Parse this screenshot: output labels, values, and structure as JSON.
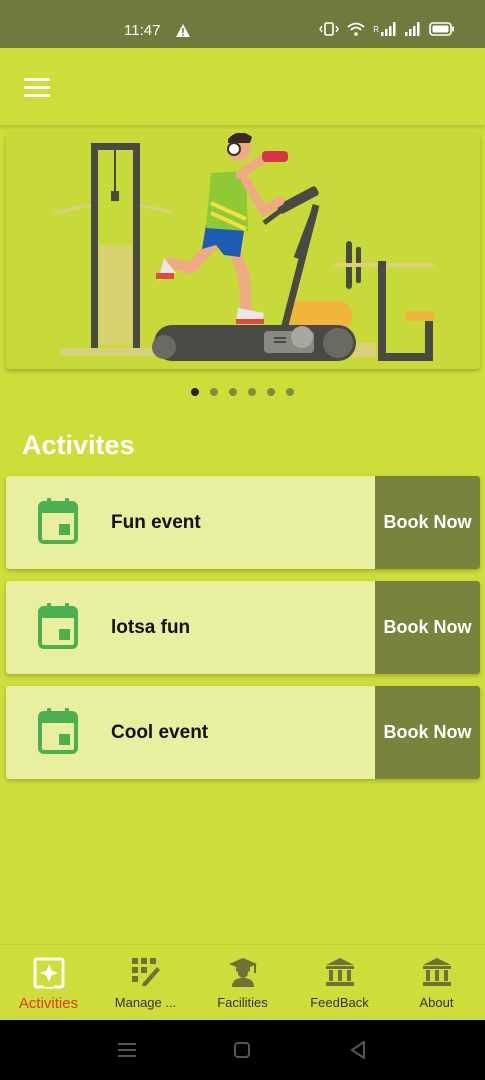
{
  "status": {
    "time": "11:47",
    "network": "R"
  },
  "section_title": "Activites",
  "carousel": {
    "count": 6,
    "active_index": 0
  },
  "events": [
    {
      "name": "Fun event",
      "button": "Book Now"
    },
    {
      "name": "lotsa fun",
      "button": "Book Now"
    },
    {
      "name": "Cool event",
      "button": "Book Now"
    }
  ],
  "nav": [
    {
      "label": "Activities",
      "icon": "activities-icon",
      "active": true
    },
    {
      "label": "Manage ...",
      "icon": "manage-icon",
      "active": false
    },
    {
      "label": "Facilities",
      "icon": "facilities-icon",
      "active": false
    },
    {
      "label": "FeedBack",
      "icon": "feedback-icon",
      "active": false
    },
    {
      "label": "About",
      "icon": "about-icon",
      "active": false
    }
  ],
  "colors": {
    "background": "#cddd3a",
    "status_bar": "#6f7b3d",
    "card": "#e8ef9f",
    "book_button": "#7a833b",
    "calendar_icon": "#4caf50",
    "active_nav": "#e53923"
  }
}
